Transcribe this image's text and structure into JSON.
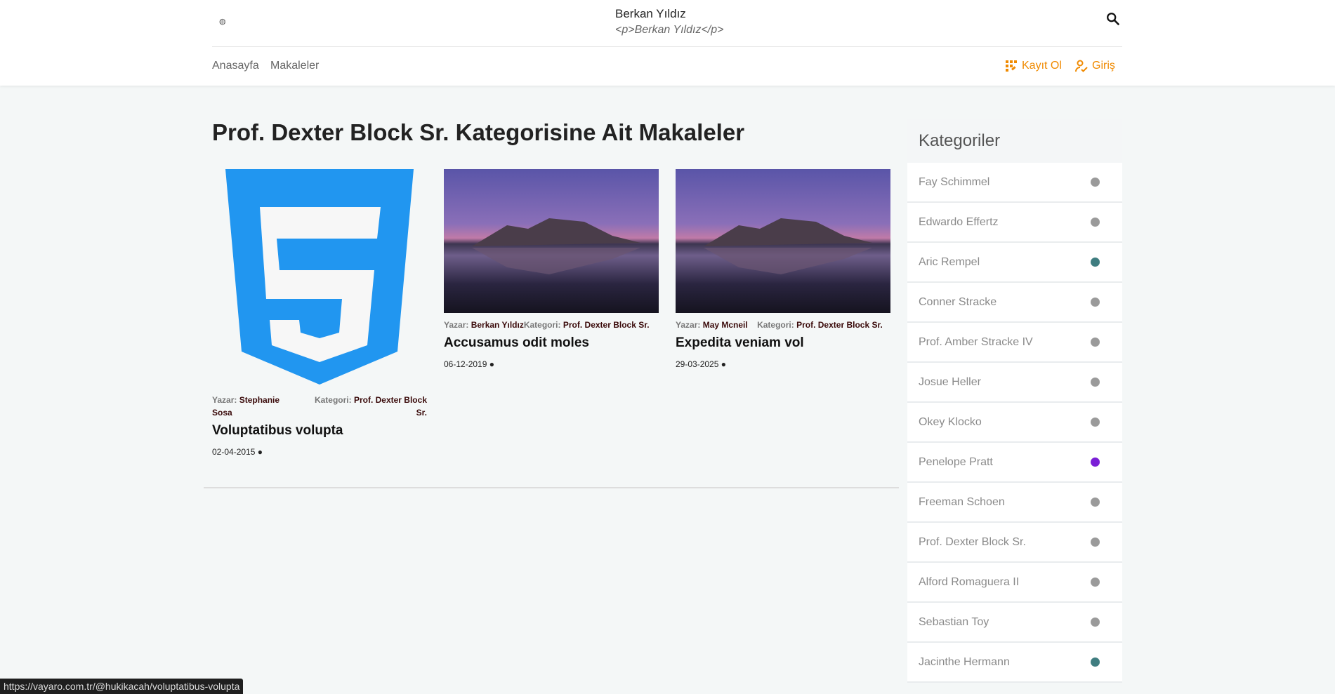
{
  "header": {
    "logo_icon": "code-brackets-icon",
    "brand": "Berkan Yıldız",
    "brand_sub": "<p>Berkan Yıldız</p>",
    "search_icon": "search-icon"
  },
  "nav": {
    "items": [
      "Anasayfa",
      "Makaleler"
    ],
    "register": "Kayıt Ol",
    "login": "Giriş",
    "accent": "#f08a00"
  },
  "main": {
    "title": "Prof. Dexter Block Sr. Kategorisine Ait Makaleler",
    "author_label": "Yazar:",
    "category_label": "Kategori:",
    "articles": [
      {
        "author": "Stephanie Sosa",
        "category": "Prof. Dexter Block Sr.",
        "title": "Voluptatibus volupta",
        "date": "02-04-2015 ●",
        "image": "css3-logo"
      },
      {
        "author": "Berkan Yıldız",
        "category": "Prof. Dexter Block Sr.",
        "title": "Accusamus odit moles",
        "date": "06-12-2019 ●",
        "image": "mountain-lake-landscape"
      },
      {
        "author": "May Mcneil",
        "category": "Prof. Dexter Block Sr.",
        "title": "Expedita veniam vol",
        "date": "29-03-2025 ●",
        "image": "mountain-lake-landscape"
      }
    ]
  },
  "sidebar": {
    "title": "Kategoriler",
    "items": [
      {
        "label": "Fay Schimmel",
        "color": "#9a9a9a"
      },
      {
        "label": "Edwardo Effertz",
        "color": "#9a9a9a"
      },
      {
        "label": "Aric Rempel",
        "color": "#3f7d80"
      },
      {
        "label": "Conner Stracke",
        "color": "#9a9a9a"
      },
      {
        "label": "Prof. Amber Stracke IV",
        "color": "#9a9a9a"
      },
      {
        "label": "Josue Heller",
        "color": "#9a9a9a"
      },
      {
        "label": "Okey Klocko",
        "color": "#9a9a9a"
      },
      {
        "label": "Penelope Pratt",
        "color": "#7a1fd6"
      },
      {
        "label": "Freeman Schoen",
        "color": "#9a9a9a"
      },
      {
        "label": "Prof. Dexter Block Sr.",
        "color": "#9a9a9a"
      },
      {
        "label": "Alford Romaguera II",
        "color": "#9a9a9a"
      },
      {
        "label": "Sebastian Toy",
        "color": "#9a9a9a"
      },
      {
        "label": "Jacinthe Hermann",
        "color": "#3f7d80"
      }
    ]
  },
  "statusbar": {
    "url": "https://vayaro.com.tr/@hukikacah/voluptatibus-volupta"
  }
}
